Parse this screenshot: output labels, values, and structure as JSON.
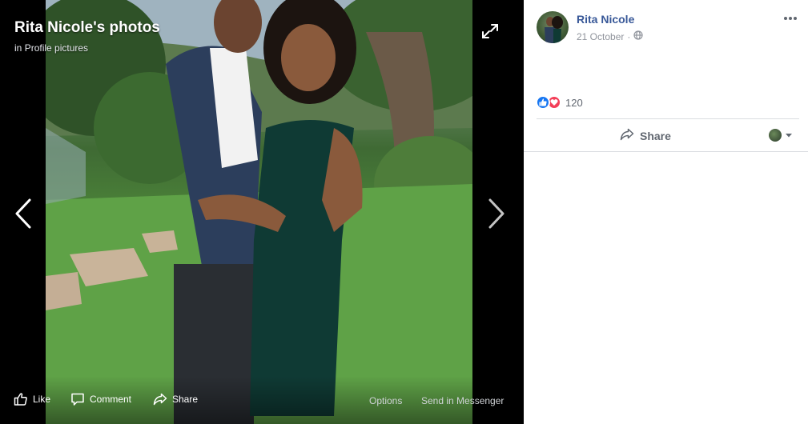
{
  "viewer": {
    "title": "Rita Nicole's photos",
    "subtitle_prefix": "in",
    "subtitle_album": "Profile pictures",
    "actions": {
      "like": "Like",
      "comment": "Comment",
      "share": "Share",
      "options": "Options",
      "send": "Send in Messenger"
    }
  },
  "post": {
    "author": "Rita Nicole",
    "date": "21 October",
    "date_separator": "·",
    "reaction_count": "120",
    "share_label": "Share"
  },
  "colors": {
    "accent": "#385898",
    "like": "#1877f2",
    "love": "#f33e58",
    "muted": "#90949c"
  },
  "icons": [
    "expand-icon",
    "chevron-left-icon",
    "chevron-right-icon",
    "like-icon",
    "comment-icon",
    "share-icon",
    "globe-icon",
    "more-icon",
    "caret-down-icon"
  ]
}
